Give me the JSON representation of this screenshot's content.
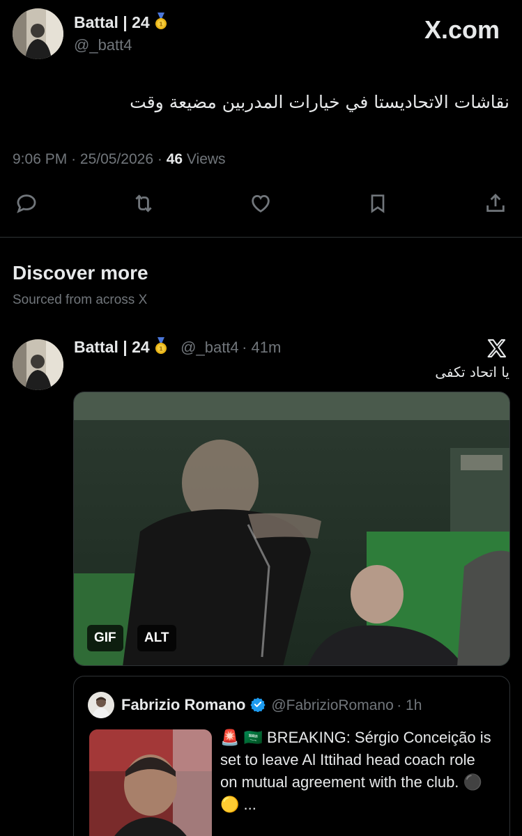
{
  "main_tweet": {
    "author_name": "Battal | 24",
    "author_handle": "@_batt4",
    "brand": "X.com",
    "text": "نقاشات الاتحاديستا في خيارات المدربين مضيعة وقت",
    "time": "9:06 PM",
    "date": "25/05/2026",
    "views_count": "46",
    "views_label": "Views",
    "separator": "·"
  },
  "actions": [
    {
      "icon": "reply-icon"
    },
    {
      "icon": "retweet-icon"
    },
    {
      "icon": "like-icon"
    },
    {
      "icon": "bookmark-icon"
    },
    {
      "icon": "share-icon"
    }
  ],
  "discover": {
    "title": "Discover more",
    "subtitle": "Sourced from across X"
  },
  "feed_tweet": {
    "author_name": "Battal | 24",
    "author_handle": "@_batt4",
    "age": "· 41m",
    "text": "يا اتحاد تكفى",
    "media_badges": [
      "GIF",
      "ALT"
    ]
  },
  "quoted_tweet": {
    "author_name": "Fabrizio Romano",
    "author_handle": "@FabrizioRomano",
    "age": "· 1h",
    "text": "🚨 🇸🇦 BREAKING: Sérgio Conceição is set to leave Al Ittihad head coach role on mutual agreement with the club. ⚫️ 🟡 ...",
    "verified_color": "#1d9bf0"
  },
  "colors": {
    "background": "#000000",
    "primary_text": "#e7e9ea",
    "secondary_text": "#71767b",
    "divider": "#2f3336"
  }
}
